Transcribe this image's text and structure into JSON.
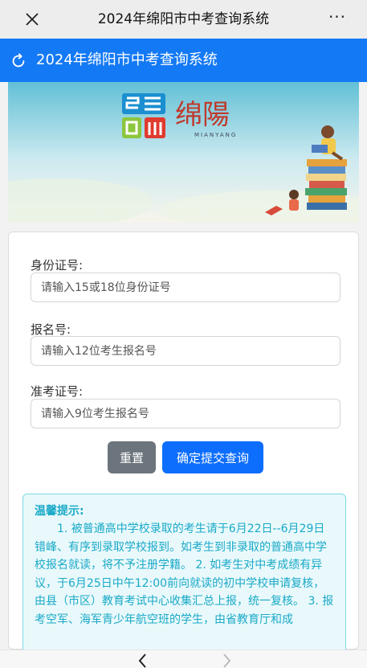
{
  "topbar": {
    "title": "2024年绵阳市中考查询系统",
    "close_icon": "close-icon",
    "more_label": "···"
  },
  "appbar": {
    "title": "2024年绵阳市中考查询系统",
    "icon": "refresh-icon",
    "color": "#1479f5"
  },
  "banner": {
    "logo_text": "绵陽",
    "logo_sub": "MIANYANG"
  },
  "form": {
    "id_label": "身份证号:",
    "id_placeholder": "请输入15或18位身份证号",
    "reg_label": "报名号:",
    "reg_placeholder": "请输入12位考生报名号",
    "ticket_label": "准考证号:",
    "ticket_placeholder": "请输入9位考生报名号",
    "reset_label": "重置",
    "submit_label": "确定提交查询"
  },
  "notice": {
    "title": "温馨提示:",
    "body": "1. 被普通高中学校录取的考生请于6月22日--6月29日错峰、有序到录取学校报到。如考生到非录取的普通高中学校报名就读，将不予注册学籍。 2. 如考生对中考成绩有异议，于6月25日中午12:00前向就读的初中学校申请复核，由县（市区）教育考试中心收集汇总上报，统一复核。 3. 报考空军、海军青少年航空班的学生，由省教育厅和成"
  },
  "colors": {
    "primary": "#0d6efd",
    "secondary": "#6c757d",
    "notice_text": "#1aa9c8",
    "notice_bg": "#e9f9fb"
  }
}
